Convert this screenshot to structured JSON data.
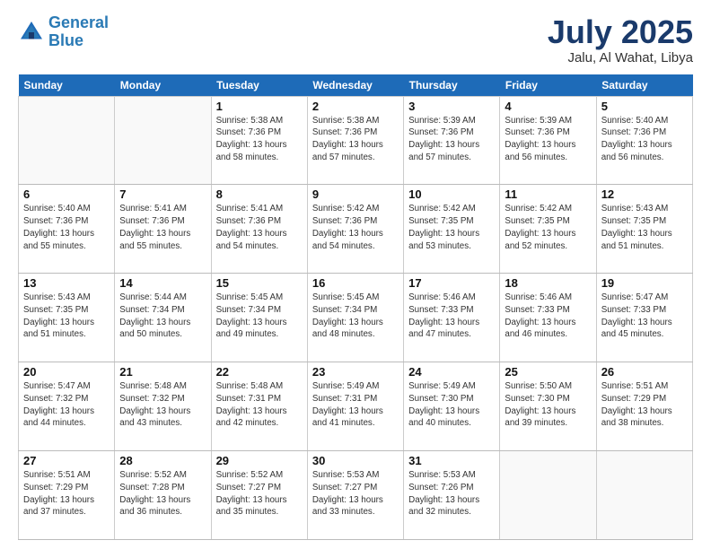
{
  "logo": {
    "line1": "General",
    "line2": "Blue"
  },
  "title": "July 2025",
  "location": "Jalu, Al Wahat, Libya",
  "days_of_week": [
    "Sunday",
    "Monday",
    "Tuesday",
    "Wednesday",
    "Thursday",
    "Friday",
    "Saturday"
  ],
  "weeks": [
    [
      {
        "day": "",
        "info": ""
      },
      {
        "day": "",
        "info": ""
      },
      {
        "day": "1",
        "info": "Sunrise: 5:38 AM\nSunset: 7:36 PM\nDaylight: 13 hours\nand 58 minutes."
      },
      {
        "day": "2",
        "info": "Sunrise: 5:38 AM\nSunset: 7:36 PM\nDaylight: 13 hours\nand 57 minutes."
      },
      {
        "day": "3",
        "info": "Sunrise: 5:39 AM\nSunset: 7:36 PM\nDaylight: 13 hours\nand 57 minutes."
      },
      {
        "day": "4",
        "info": "Sunrise: 5:39 AM\nSunset: 7:36 PM\nDaylight: 13 hours\nand 56 minutes."
      },
      {
        "day": "5",
        "info": "Sunrise: 5:40 AM\nSunset: 7:36 PM\nDaylight: 13 hours\nand 56 minutes."
      }
    ],
    [
      {
        "day": "6",
        "info": "Sunrise: 5:40 AM\nSunset: 7:36 PM\nDaylight: 13 hours\nand 55 minutes."
      },
      {
        "day": "7",
        "info": "Sunrise: 5:41 AM\nSunset: 7:36 PM\nDaylight: 13 hours\nand 55 minutes."
      },
      {
        "day": "8",
        "info": "Sunrise: 5:41 AM\nSunset: 7:36 PM\nDaylight: 13 hours\nand 54 minutes."
      },
      {
        "day": "9",
        "info": "Sunrise: 5:42 AM\nSunset: 7:36 PM\nDaylight: 13 hours\nand 54 minutes."
      },
      {
        "day": "10",
        "info": "Sunrise: 5:42 AM\nSunset: 7:35 PM\nDaylight: 13 hours\nand 53 minutes."
      },
      {
        "day": "11",
        "info": "Sunrise: 5:42 AM\nSunset: 7:35 PM\nDaylight: 13 hours\nand 52 minutes."
      },
      {
        "day": "12",
        "info": "Sunrise: 5:43 AM\nSunset: 7:35 PM\nDaylight: 13 hours\nand 51 minutes."
      }
    ],
    [
      {
        "day": "13",
        "info": "Sunrise: 5:43 AM\nSunset: 7:35 PM\nDaylight: 13 hours\nand 51 minutes."
      },
      {
        "day": "14",
        "info": "Sunrise: 5:44 AM\nSunset: 7:34 PM\nDaylight: 13 hours\nand 50 minutes."
      },
      {
        "day": "15",
        "info": "Sunrise: 5:45 AM\nSunset: 7:34 PM\nDaylight: 13 hours\nand 49 minutes."
      },
      {
        "day": "16",
        "info": "Sunrise: 5:45 AM\nSunset: 7:34 PM\nDaylight: 13 hours\nand 48 minutes."
      },
      {
        "day": "17",
        "info": "Sunrise: 5:46 AM\nSunset: 7:33 PM\nDaylight: 13 hours\nand 47 minutes."
      },
      {
        "day": "18",
        "info": "Sunrise: 5:46 AM\nSunset: 7:33 PM\nDaylight: 13 hours\nand 46 minutes."
      },
      {
        "day": "19",
        "info": "Sunrise: 5:47 AM\nSunset: 7:33 PM\nDaylight: 13 hours\nand 45 minutes."
      }
    ],
    [
      {
        "day": "20",
        "info": "Sunrise: 5:47 AM\nSunset: 7:32 PM\nDaylight: 13 hours\nand 44 minutes."
      },
      {
        "day": "21",
        "info": "Sunrise: 5:48 AM\nSunset: 7:32 PM\nDaylight: 13 hours\nand 43 minutes."
      },
      {
        "day": "22",
        "info": "Sunrise: 5:48 AM\nSunset: 7:31 PM\nDaylight: 13 hours\nand 42 minutes."
      },
      {
        "day": "23",
        "info": "Sunrise: 5:49 AM\nSunset: 7:31 PM\nDaylight: 13 hours\nand 41 minutes."
      },
      {
        "day": "24",
        "info": "Sunrise: 5:49 AM\nSunset: 7:30 PM\nDaylight: 13 hours\nand 40 minutes."
      },
      {
        "day": "25",
        "info": "Sunrise: 5:50 AM\nSunset: 7:30 PM\nDaylight: 13 hours\nand 39 minutes."
      },
      {
        "day": "26",
        "info": "Sunrise: 5:51 AM\nSunset: 7:29 PM\nDaylight: 13 hours\nand 38 minutes."
      }
    ],
    [
      {
        "day": "27",
        "info": "Sunrise: 5:51 AM\nSunset: 7:29 PM\nDaylight: 13 hours\nand 37 minutes."
      },
      {
        "day": "28",
        "info": "Sunrise: 5:52 AM\nSunset: 7:28 PM\nDaylight: 13 hours\nand 36 minutes."
      },
      {
        "day": "29",
        "info": "Sunrise: 5:52 AM\nSunset: 7:27 PM\nDaylight: 13 hours\nand 35 minutes."
      },
      {
        "day": "30",
        "info": "Sunrise: 5:53 AM\nSunset: 7:27 PM\nDaylight: 13 hours\nand 33 minutes."
      },
      {
        "day": "31",
        "info": "Sunrise: 5:53 AM\nSunset: 7:26 PM\nDaylight: 13 hours\nand 32 minutes."
      },
      {
        "day": "",
        "info": ""
      },
      {
        "day": "",
        "info": ""
      }
    ]
  ]
}
